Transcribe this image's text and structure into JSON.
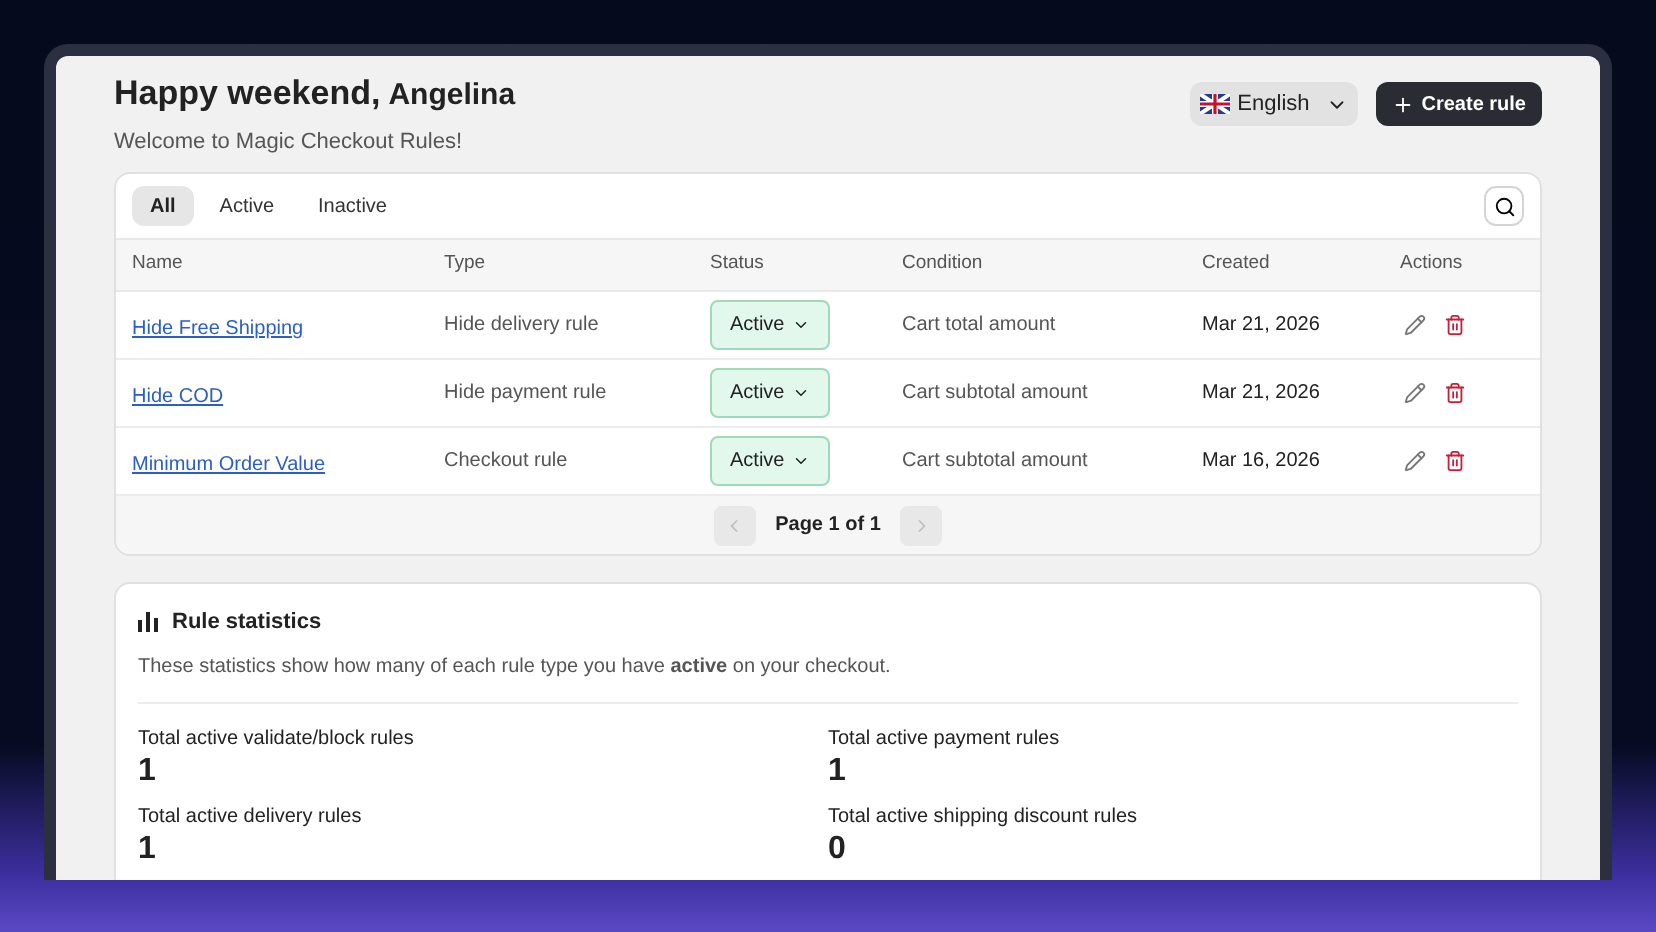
{
  "header": {
    "greeting": "Happy weekend,",
    "name": "Angelina",
    "subtitle": "Welcome to Magic Checkout Rules!"
  },
  "language": {
    "label": "English"
  },
  "create_button": {
    "label": "Create rule"
  },
  "tabs": [
    {
      "label": "All",
      "selected": true
    },
    {
      "label": "Active",
      "selected": false
    },
    {
      "label": "Inactive",
      "selected": false
    }
  ],
  "table": {
    "columns": [
      "Name",
      "Type",
      "Status",
      "Condition",
      "Created",
      "Actions"
    ],
    "rows": [
      {
        "name": "Hide Free Shipping",
        "type": "Hide delivery rule",
        "status": "Active",
        "condition": "Cart total amount",
        "created": "Mar 21, 2026"
      },
      {
        "name": "Hide COD",
        "type": "Hide payment rule",
        "status": "Active",
        "condition": "Cart subtotal amount",
        "created": "Mar 21, 2026"
      },
      {
        "name": "Minimum Order Value",
        "type": "Checkout rule",
        "status": "Active",
        "condition": "Cart subtotal amount",
        "created": "Mar 16, 2026"
      }
    ]
  },
  "pagination": {
    "label": "Page 1 of 1",
    "prev_disabled": true,
    "next_disabled": true
  },
  "statistics": {
    "title": "Rule statistics",
    "description": "These statistics show how many of each rule type you have **active** on your checkout.",
    "items": [
      {
        "label": "Total active validate/block rules",
        "value": "1"
      },
      {
        "label": "Total active payment rules",
        "value": "1"
      },
      {
        "label": "Total active delivery rules",
        "value": "1"
      },
      {
        "label": "Total active shipping discount rules",
        "value": "0"
      }
    ]
  }
}
